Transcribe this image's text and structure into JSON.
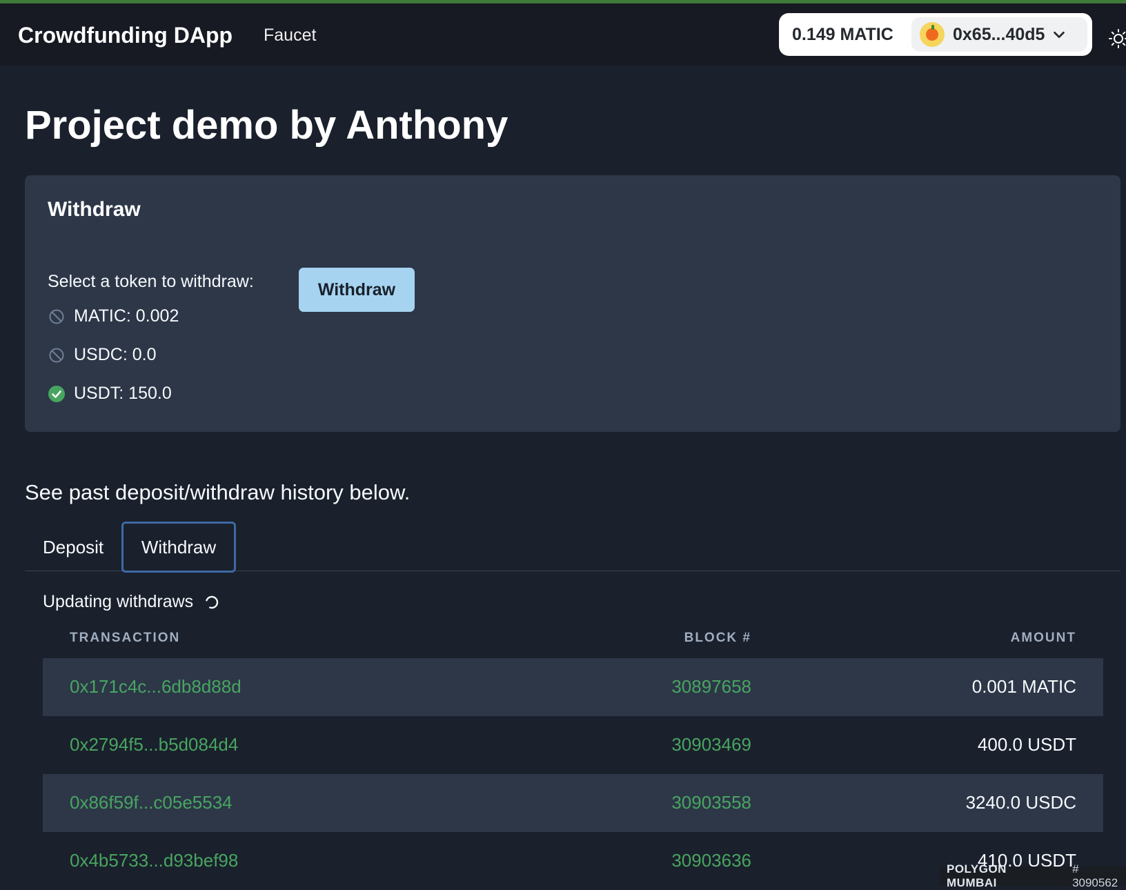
{
  "navbar": {
    "brand": "Crowdfunding DApp",
    "faucet_link": "Faucet",
    "wallet_balance": "0.149 MATIC",
    "wallet_address": "0x65...40d5"
  },
  "page": {
    "title": "Project demo by Anthony"
  },
  "withdraw_card": {
    "title": "Withdraw",
    "select_label": "Select a token to withdraw:",
    "button_label": "Withdraw",
    "tokens": [
      {
        "label": "MATIC: 0.002",
        "state": "disabled"
      },
      {
        "label": "USDC: 0.0",
        "state": "disabled"
      },
      {
        "label": "USDT: 150.0",
        "state": "selected"
      }
    ]
  },
  "history": {
    "note": "See past deposit/withdraw history below.",
    "tabs": [
      {
        "label": "Deposit",
        "active": false
      },
      {
        "label": "Withdraw",
        "active": true
      }
    ],
    "status": "Updating withdraws",
    "columns": {
      "transaction": "TRANSACTION",
      "block": "BLOCK #",
      "amount": "AMOUNT"
    },
    "rows": [
      {
        "tx": "0x171c4c...6db8d88d",
        "block": "30897658",
        "amount": "0.001 MATIC"
      },
      {
        "tx": "0x2794f5...b5d084d4",
        "block": "30903469",
        "amount": "400.0 USDT"
      },
      {
        "tx": "0x86f59f...c05e5534",
        "block": "30903558",
        "amount": "3240.0 USDC"
      },
      {
        "tx": "0x4b5733...d93bef98",
        "block": "30903636",
        "amount": "410.0 USDT"
      }
    ]
  },
  "network_badge": {
    "name": "POLYGON MUMBAI",
    "block": "# 3090562"
  },
  "colors": {
    "background": "#1a202c",
    "navbar": "#171923",
    "card": "#2d3748",
    "accent_green": "#48a560",
    "button": "#a6d4f0",
    "tab_border": "#3e6aa3"
  }
}
